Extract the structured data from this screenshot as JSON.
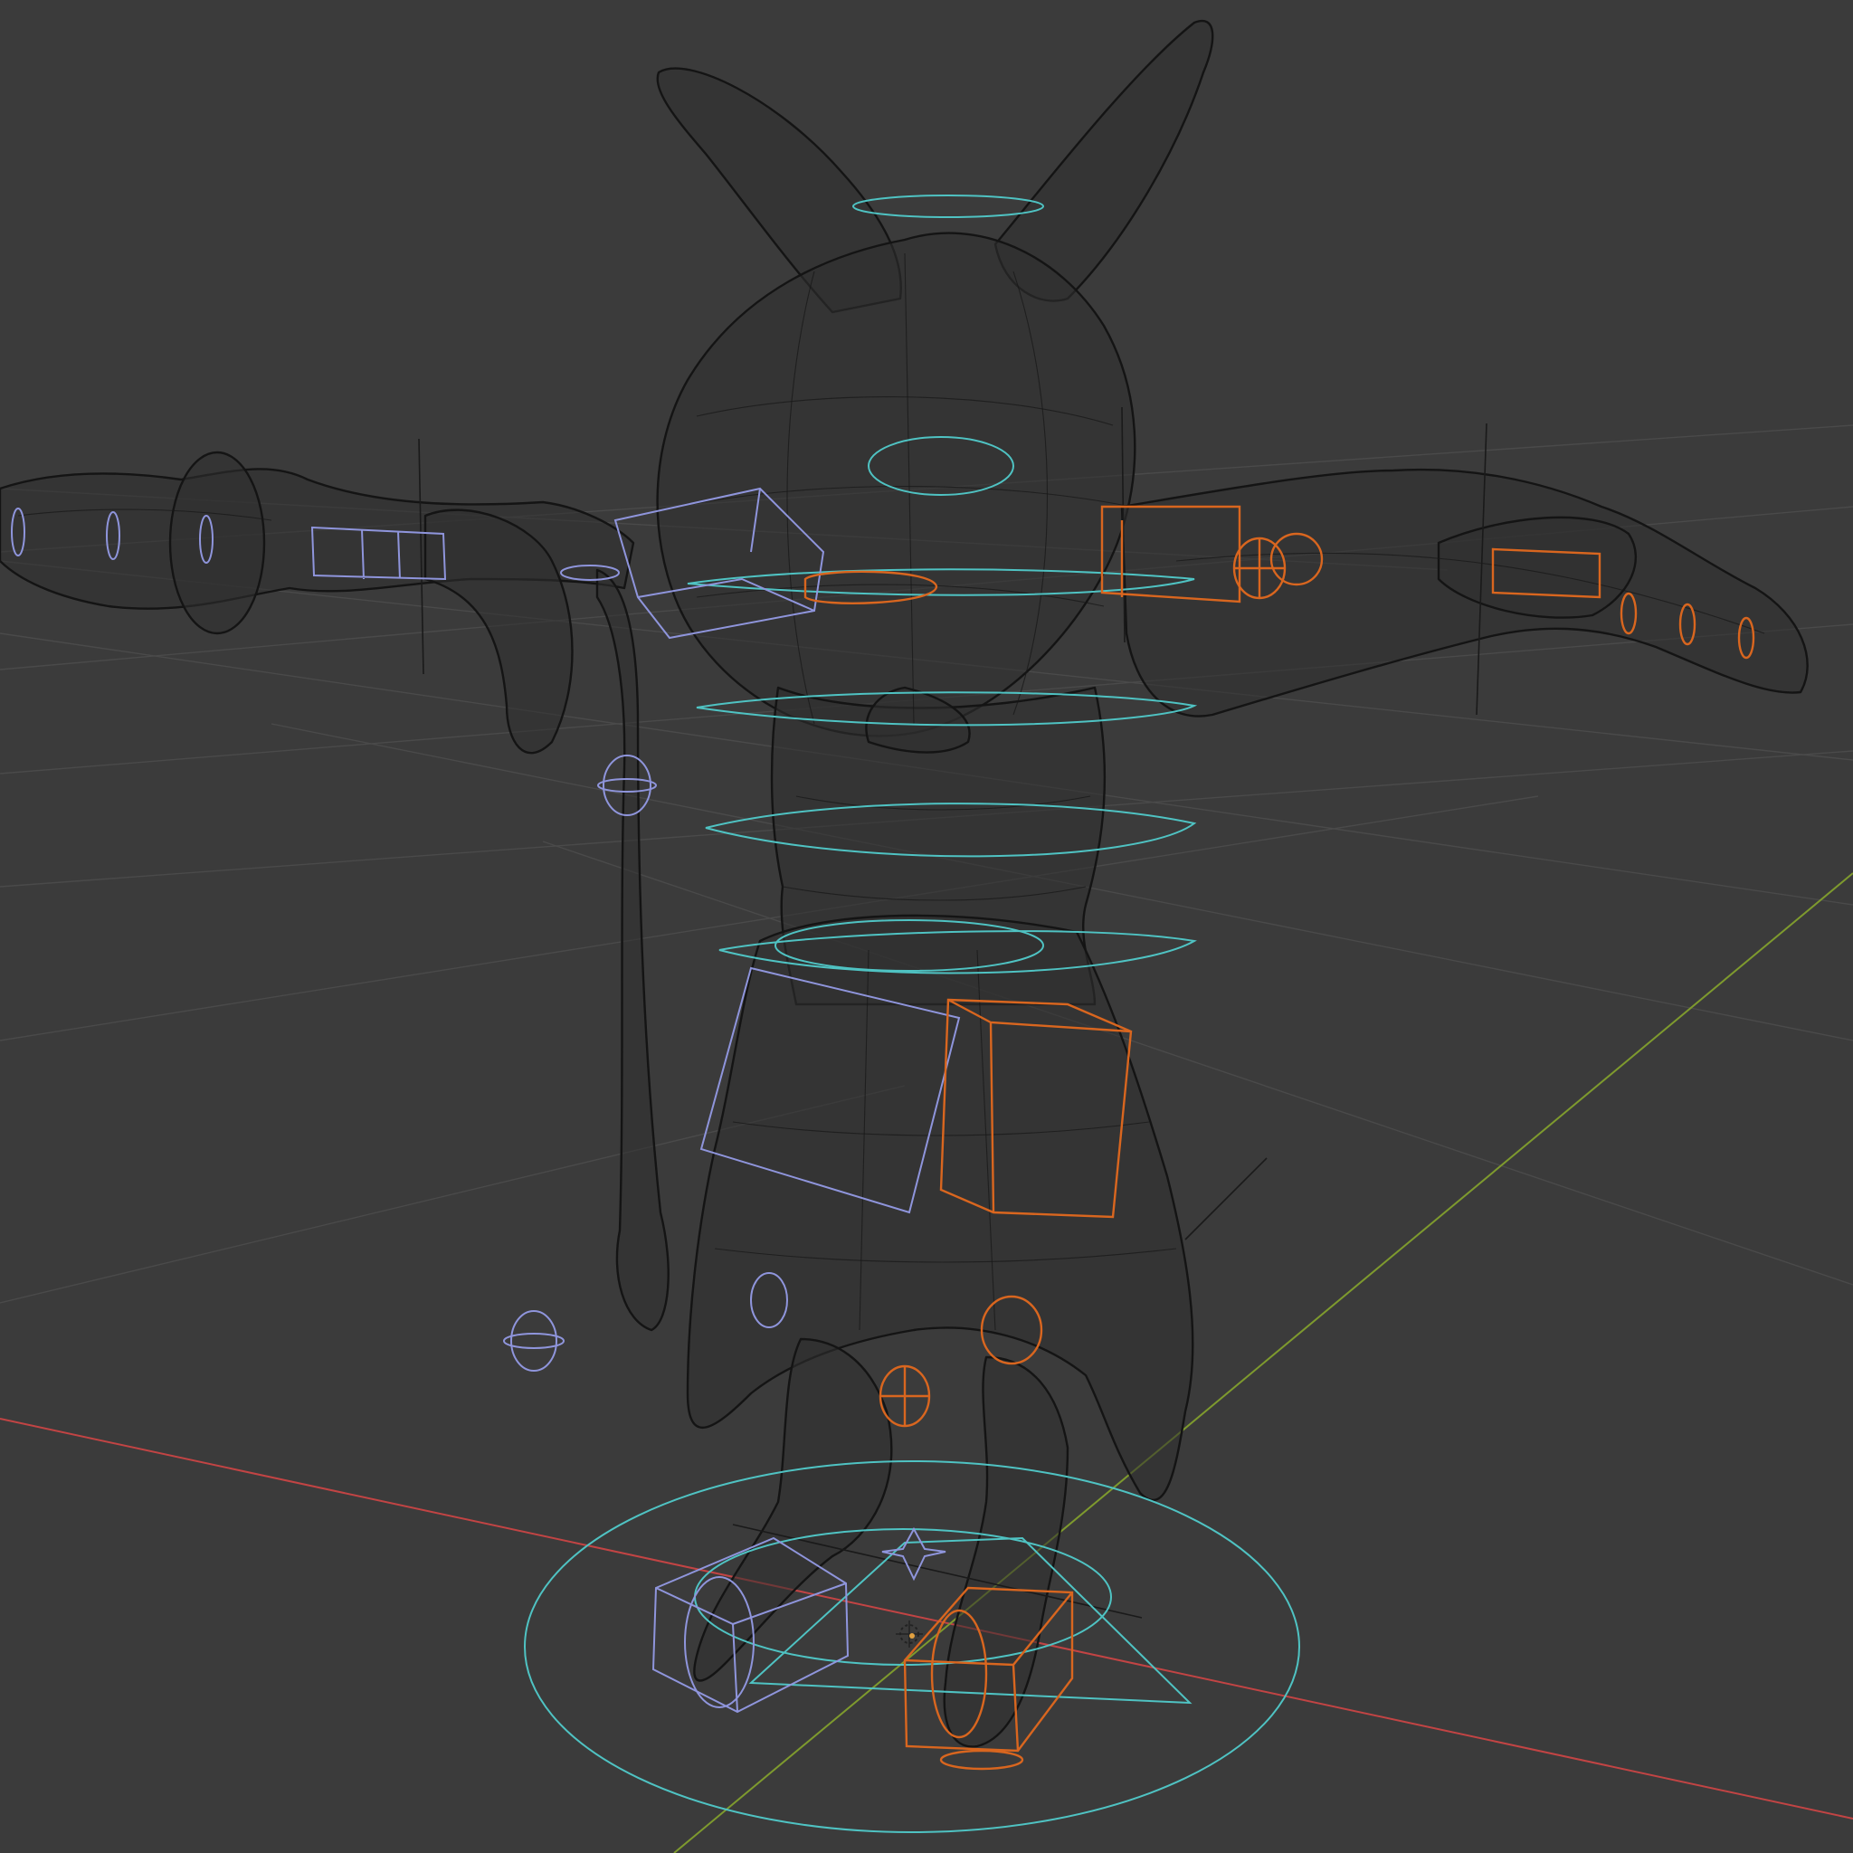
{
  "viewport": {
    "shading": "wireframe",
    "background": "#3b3b3b",
    "grid_color": "#4a4a4a",
    "axis_x_color": "#c24444",
    "axis_y_color": "#7e9a2e",
    "mesh_wire_color": "#141414"
  },
  "rig": {
    "left_controls_color": "#8f95dc",
    "right_controls_color": "#d9661f",
    "center_controls_color": "#4fc3c3"
  }
}
